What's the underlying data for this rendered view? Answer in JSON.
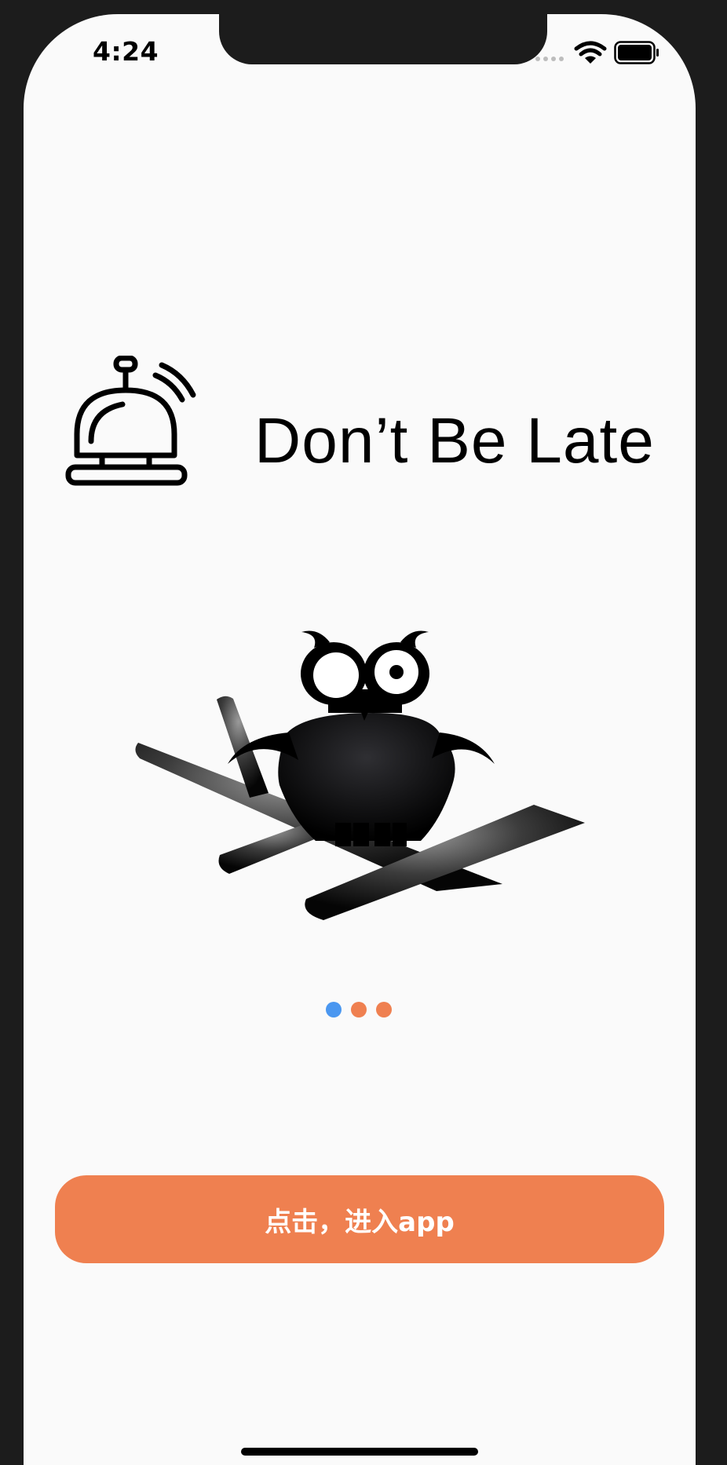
{
  "status_bar": {
    "time": "4:24",
    "icons": [
      "signal-dots-icon",
      "wifi-icon",
      "battery-icon"
    ]
  },
  "hero": {
    "icon": "service-bell-icon",
    "title": "Don’t Be Late"
  },
  "illustration": {
    "icon": "owl-on-branch-illustration"
  },
  "pager": {
    "total_pages": 3,
    "current_page": 1,
    "active_color": "#4a97f0",
    "inactive_color": "#ef8050"
  },
  "enter_button": {
    "label": "点击，进入app",
    "background": "#ef8050",
    "text_color": "#ffffff"
  },
  "colors": {
    "screen_background": "#fafafa",
    "device_frame": "#1c1c1c"
  }
}
